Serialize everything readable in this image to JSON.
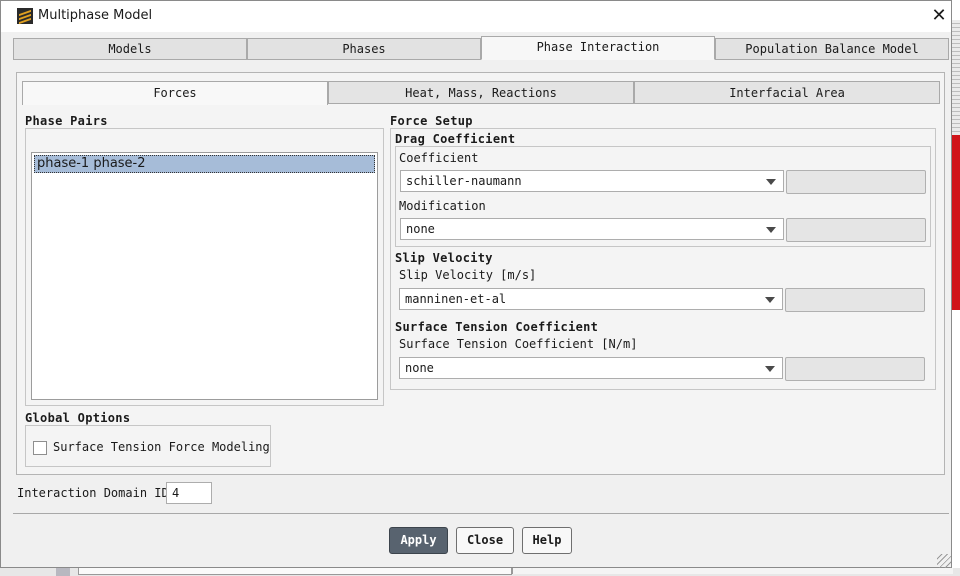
{
  "window": {
    "title": "Multiphase Model",
    "close_label": "✕"
  },
  "tabs": [
    {
      "label": "Models"
    },
    {
      "label": "Phases"
    },
    {
      "label": "Phase Interaction"
    },
    {
      "label": "Population Balance Model"
    }
  ],
  "subtabs": [
    {
      "label": "Forces"
    },
    {
      "label": "Heat, Mass, Reactions"
    },
    {
      "label": "Interfacial Area"
    }
  ],
  "phase_pairs": {
    "heading": "Phase Pairs",
    "items": [
      "phase-1 phase-2"
    ]
  },
  "global_options": {
    "heading": "Global Options",
    "surface_tension_force_modeling": {
      "label": "Surface Tension Force Modeling",
      "checked": false
    }
  },
  "force_setup": {
    "heading": "Force Setup",
    "drag": {
      "heading": "Drag Coefficient",
      "coefficient_label": "Coefficient",
      "coefficient_value": "schiller-naumann",
      "modification_label": "Modification",
      "modification_value": "none"
    },
    "slip": {
      "heading": "Slip Velocity",
      "label": "Slip Velocity [m/s]",
      "value": "manninen-et-al"
    },
    "surface_tension": {
      "heading": "Surface Tension Coefficient",
      "label": "Surface Tension Coefficient [N/m]",
      "value": "none"
    }
  },
  "interaction_domain": {
    "label": "Interaction Domain ID",
    "value": "4"
  },
  "buttons": {
    "apply": "Apply",
    "close": "Close",
    "help": "Help"
  }
}
